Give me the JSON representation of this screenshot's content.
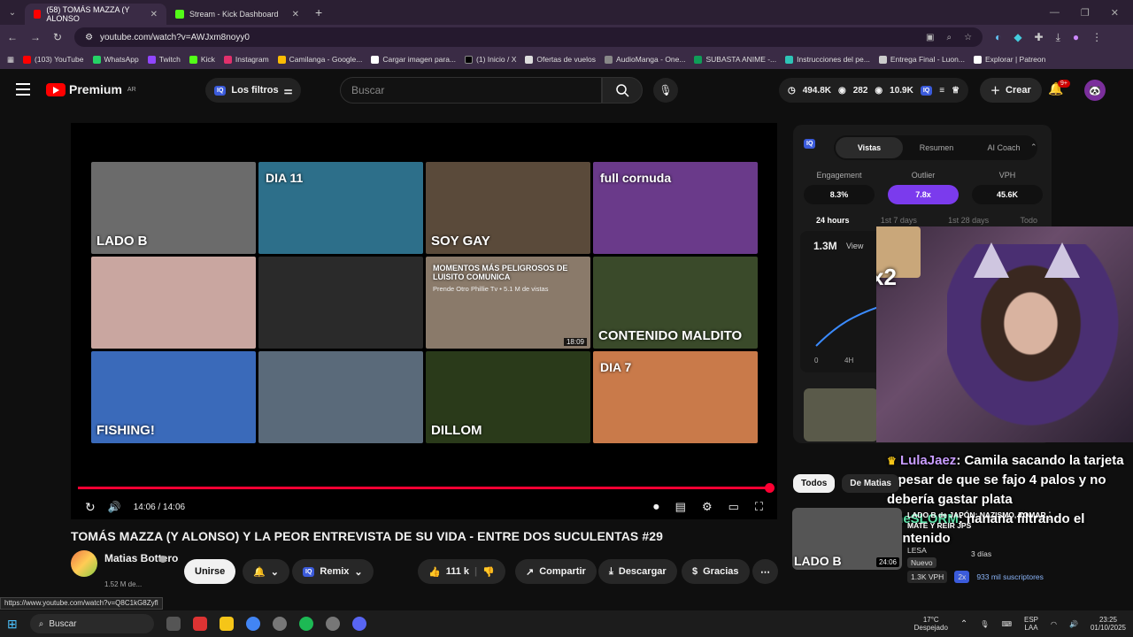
{
  "browser": {
    "tabs": [
      {
        "label": "(58) TOMÁS MAZZA (Y ALONSO",
        "active": true
      },
      {
        "label": "Stream - Kick Dashboard",
        "active": false
      }
    ],
    "url": "youtube.com/watch?v=AWJxm8noyy0",
    "bookmarks": [
      "(103) YouTube",
      "WhatsApp",
      "Twitch",
      "Kick",
      "Instagram",
      "Camilanga - Google...",
      "Cargar imagen para...",
      "(1) Inicio / X",
      "Ofertas de vuelos",
      "AudioManga - One...",
      "SUBASTA ANIME -...",
      "Instrucciones del pe...",
      "Entrega Final - Luon...",
      "Explorar | Patreon"
    ]
  },
  "yt": {
    "brand": "Premium",
    "region": "AR",
    "filters_label": "Los filtros",
    "search_placeholder": "Buscar",
    "stats": {
      "views": "494.8K",
      "viewers": "282",
      "other": "10.9K"
    },
    "create_label": "Crear",
    "notif_count": "9+"
  },
  "player": {
    "time": "14:06 / 14:06",
    "thumbs": [
      {
        "text": "LADO B",
        "color": "#6b6b6b"
      },
      {
        "text": "DIA 11",
        "color": "#2d6f8a"
      },
      {
        "text": "SOY GAY",
        "color": "#5a4a3a"
      },
      {
        "text": "full cornuda",
        "color": "#6a3a8a"
      },
      {
        "text": "",
        "color": "#c9a6a0"
      },
      {
        "text": "",
        "color": "#2a2a2a"
      },
      {
        "text": "MOMENTOS MÁS PELIGROSOS DE LUISITO COMUNICA",
        "color": "#8a7a6a"
      },
      {
        "text": "CONTENIDO MALDITO",
        "color": "#3a4a2a"
      },
      {
        "text": "FISHING!",
        "color": "#3a6aba"
      },
      {
        "text": "",
        "color": "#5a6a7a"
      },
      {
        "text": "DILLOM",
        "color": "#2a3a1a"
      },
      {
        "text": "DIA 7",
        "color": "#c97a4a"
      }
    ],
    "overlay_sub": "Prende Otro Phillie Tv • 5.1 M de vistas",
    "overlay_dur": "18:09"
  },
  "video": {
    "title": "TOMÁS MAZZA (Y ALONSO) Y LA PEOR ENTREVISTA DE SU VIDA - ENTRE DOS SUCULENTAS #29",
    "channel": "Matias Bottero",
    "subs": "1.52 M de...",
    "join": "Unirse",
    "remix": "Remix",
    "likes": "111 k",
    "share": "Compartir",
    "download": "Descargar",
    "thanks": "Gracias"
  },
  "iq": {
    "tabs": [
      "Vistas",
      "Resumen",
      "AI Coach"
    ],
    "metrics": [
      {
        "label": "Engagement",
        "value": "8.3%"
      },
      {
        "label": "Outlier",
        "value": "7.8x"
      },
      {
        "label": "VPH",
        "value": "45.6K"
      }
    ],
    "ranges": [
      "24 hours",
      "1st 7 days",
      "1st 28 days",
      "Todo"
    ],
    "chart_value": "1.3M",
    "chart_label": "View",
    "axis": [
      "0",
      "4H"
    ]
  },
  "stream": {
    "overlay": "x2",
    "chat": [
      {
        "user": "LulaJaez",
        "color": "#c89cff",
        "msg": ": Camila sacando la tarjeta a pesar de que se fajo 4 palos y no debería gastar plata"
      },
      {
        "user": "TheSLORM",
        "color": "#5de0a8",
        "msg": ": nanana filtrando el contenido"
      }
    ]
  },
  "recs": {
    "chips": [
      "Todos",
      "De Matias"
    ],
    "item": {
      "title": "LADO B de JAPÓN: NAZISMO, TOMAR MATE Y REIR JPS",
      "channel": "LESA",
      "age": "3 días",
      "badge": "Nuevo",
      "vph": "1.3K VPH",
      "mult": "2x",
      "subs": "933 mil suscriptores",
      "duration": "24:06"
    }
  },
  "status_url": "https://www.youtube.com/watch?v=Q8C1kG8Zyfl",
  "taskbar": {
    "search": "Buscar",
    "weather": "17°C",
    "weather_desc": "Despejado",
    "lang": "ESP",
    "lang2": "LAA",
    "time": "23:25",
    "date": "01/10/2025"
  }
}
